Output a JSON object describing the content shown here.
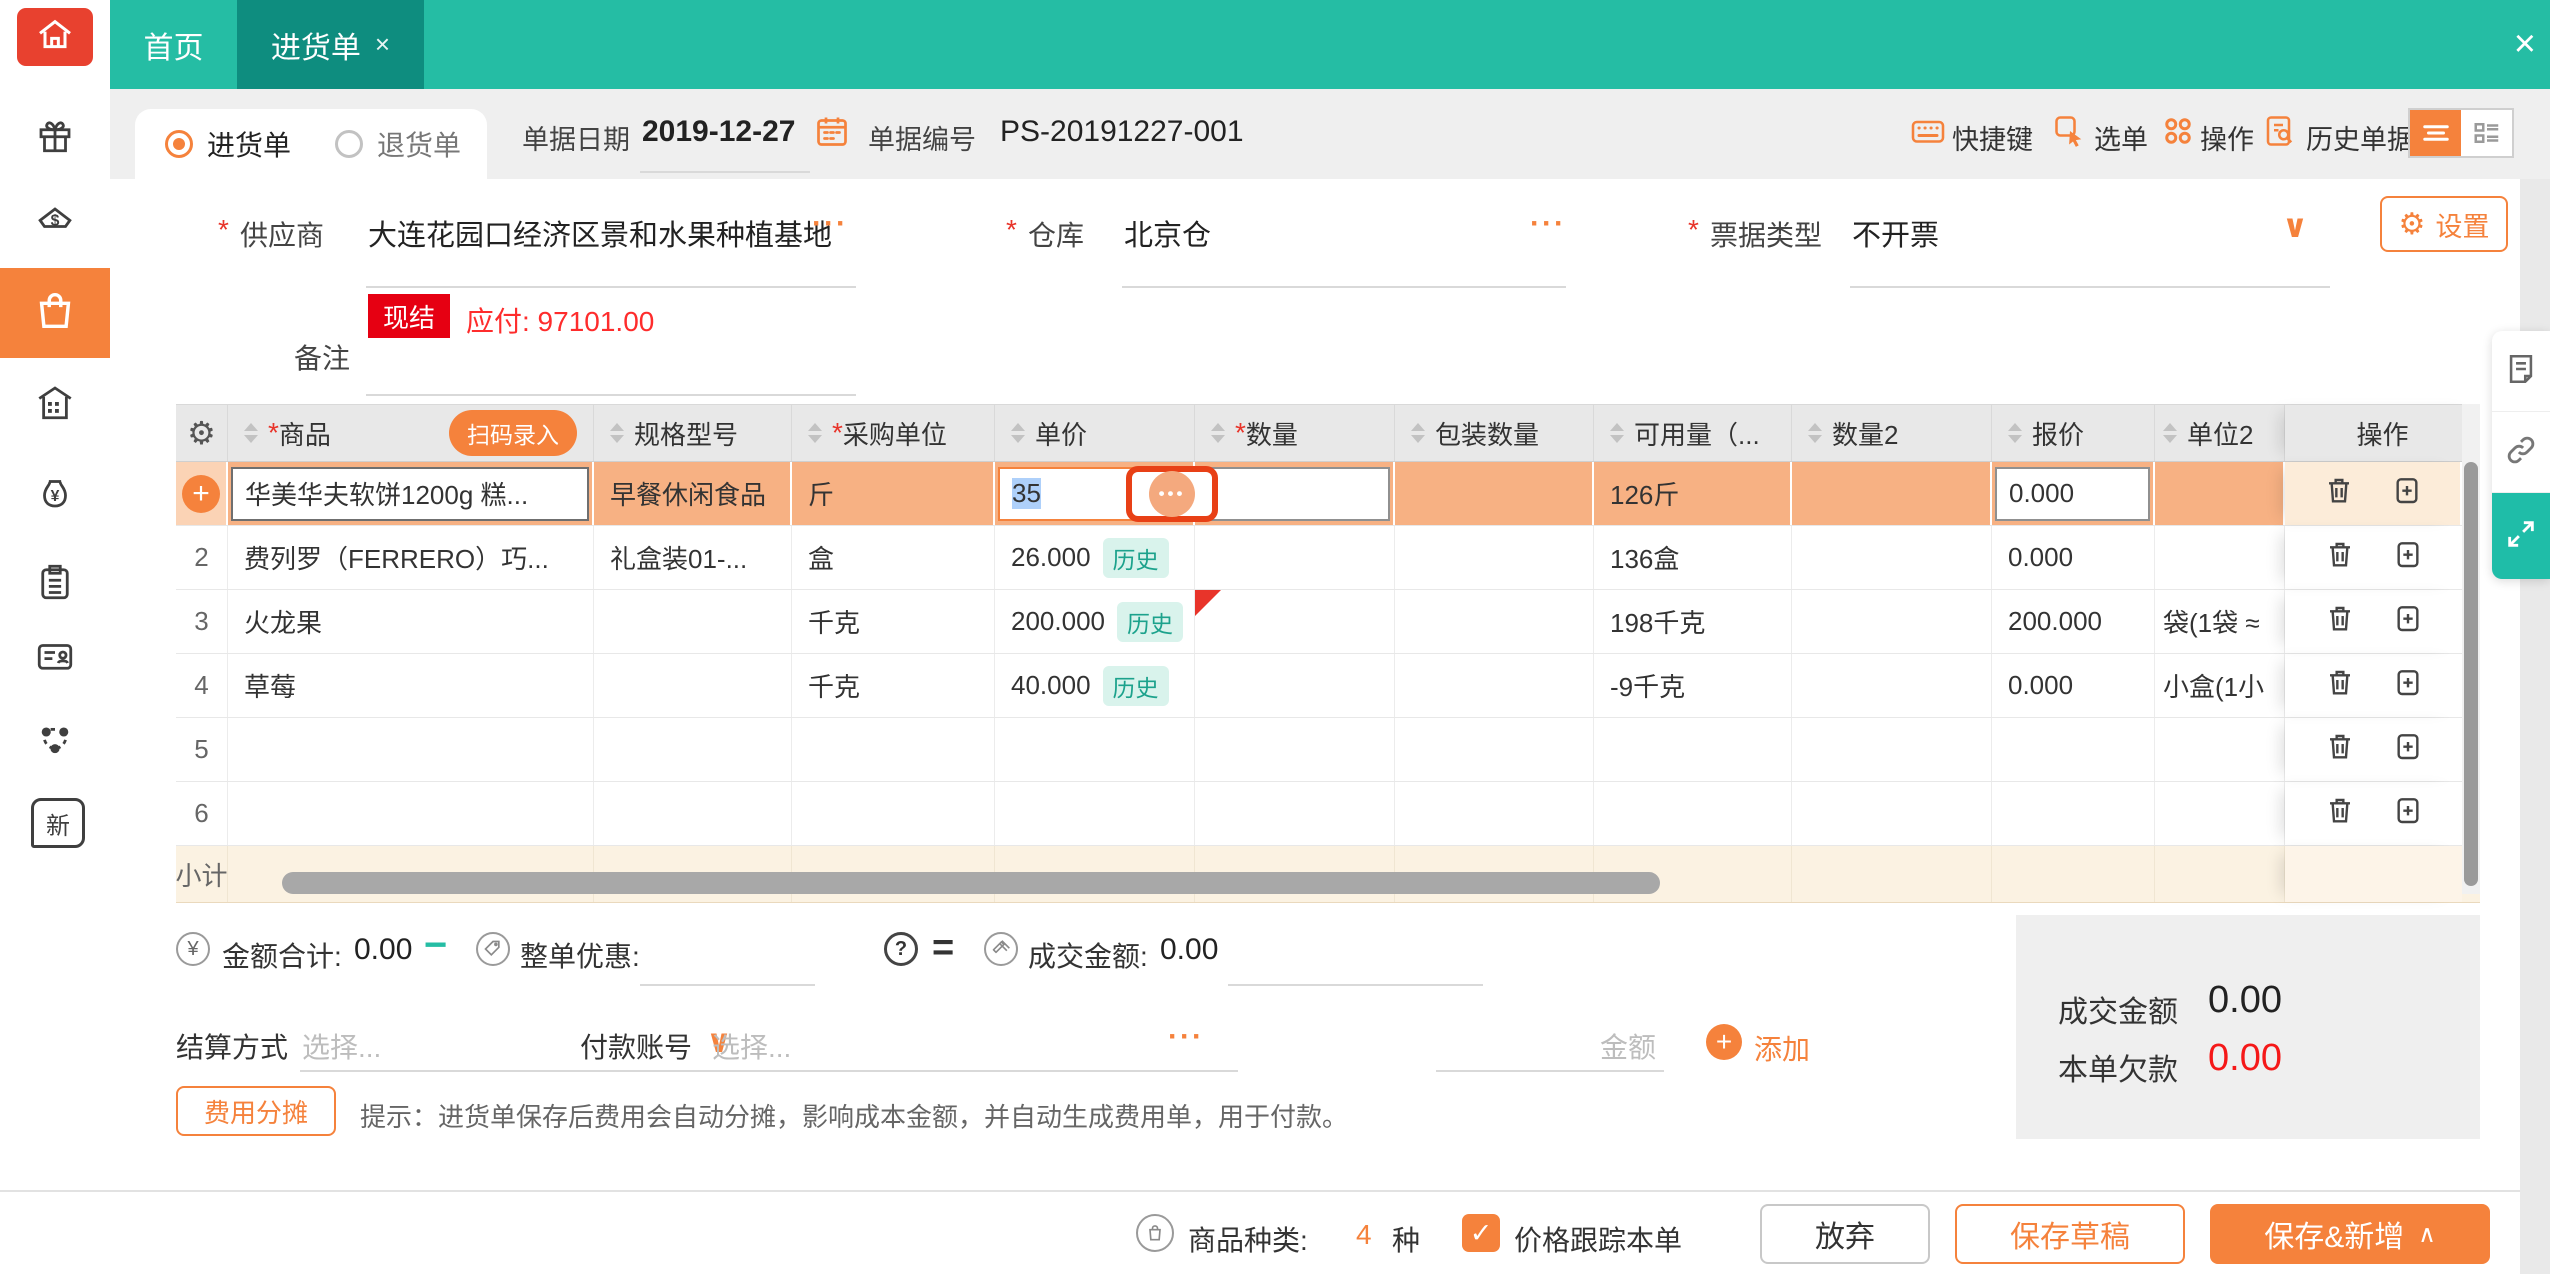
{
  "colors": {
    "accent": "#f5823c",
    "teal": "#25bda4",
    "teal_dark": "#0e8d7f",
    "red": "#e8342a",
    "badge_red": "#e60012",
    "row_highlight": "#f7b183"
  },
  "icons": {
    "close": "×",
    "check": "✓",
    "plus": "+",
    "dots": "•••",
    "more": "···",
    "minus": "−",
    "equals": "=",
    "question": "?",
    "yen": "¥",
    "caret_up": "∧",
    "chevron_down": "∨",
    "gear": "⚙"
  },
  "topbar": {
    "tab_home": "首页",
    "tab_active": "进货单"
  },
  "sidebar": {
    "new_label": "新"
  },
  "toolbar": {
    "radio_purchase": "进货单",
    "radio_return": "退货单",
    "date_label": "单据日期",
    "date_value": "2019-12-27",
    "number_label": "单据编号",
    "number_value": "PS-20191227-001",
    "hotkeys": "快捷键",
    "pick": "选单",
    "ops": "操作",
    "history": "历史单据"
  },
  "form": {
    "star": "*",
    "supplier_label": "供应商",
    "supplier_value": "大连花园口经济区景和水果种植基地",
    "settle_badge": "现结",
    "payable_text": "应付: 97101.00",
    "remark_label": "备注",
    "warehouse_label": "仓库",
    "warehouse_value": "北京仓",
    "bill_type_label": "票据类型",
    "bill_type_value": "不开票",
    "settings_label": "设置"
  },
  "table": {
    "scan_label": "扫码录入",
    "history_badge": "历史",
    "subtotal": "小计",
    "headers": {
      "product": "商品",
      "spec": "规格型号",
      "purchase_unit": "采购单位",
      "price": "单价",
      "qty": "数量",
      "pack_qty": "包装数量",
      "available": "可用量（...",
      "qty2": "数量2",
      "quote": "报价",
      "unit2": "单位2",
      "ops": "操作"
    },
    "rows": [
      {
        "no": "+",
        "product": "华美华夫软饼1200g 糕...",
        "spec": "早餐休闲食品",
        "unit": "斤",
        "price": "35",
        "qty": "",
        "available": "126斤",
        "quote": "0.000",
        "unit2": ""
      },
      {
        "no": "2",
        "product": "费列罗（FERRERO）巧...",
        "spec": "礼盒装01-...",
        "unit": "盒",
        "price": "26.000",
        "available": "136盒",
        "quote": "0.000",
        "unit2": ""
      },
      {
        "no": "3",
        "product": "火龙果",
        "spec": "",
        "unit": "千克",
        "price": "200.000",
        "available": "198千克",
        "quote": "200.000",
        "unit2": "袋(1袋 ≈"
      },
      {
        "no": "4",
        "product": "草莓",
        "spec": "",
        "unit": "千克",
        "price": "40.000",
        "available": "-9千克",
        "quote": "0.000",
        "unit2": "小盒(1小"
      },
      {
        "no": "5"
      },
      {
        "no": "6"
      }
    ]
  },
  "summary": {
    "total_label": "金额合计:",
    "total_value": "0.00",
    "minus": "−",
    "discount_label": "整单优惠:",
    "question": "?",
    "equals": "=",
    "deal_label": "成交金额:",
    "deal_value": "0.00"
  },
  "payment": {
    "method_label": "结算方式",
    "method_placeholder": "选择...",
    "account_label": "付款账号",
    "account_placeholder": "选择...",
    "amount_placeholder": "金额",
    "add_label": "添加",
    "fee_badge": "费用分摊",
    "fee_hint": "提示：进货单保存后费用会自动分摊，影响成本金额，并自动生成费用单，用于付款。"
  },
  "totals_panel": {
    "deal_label": "成交金额",
    "deal_value": "0.00",
    "debt_label": "本单欠款",
    "debt_value": "0.00"
  },
  "footer": {
    "kinds_label": "商品种类:",
    "kinds_value": "4",
    "kinds_unit": "种",
    "track_label": "价格跟踪本单",
    "cancel": "放弃",
    "save_draft": "保存草稿",
    "save_new": "保存&新增"
  }
}
